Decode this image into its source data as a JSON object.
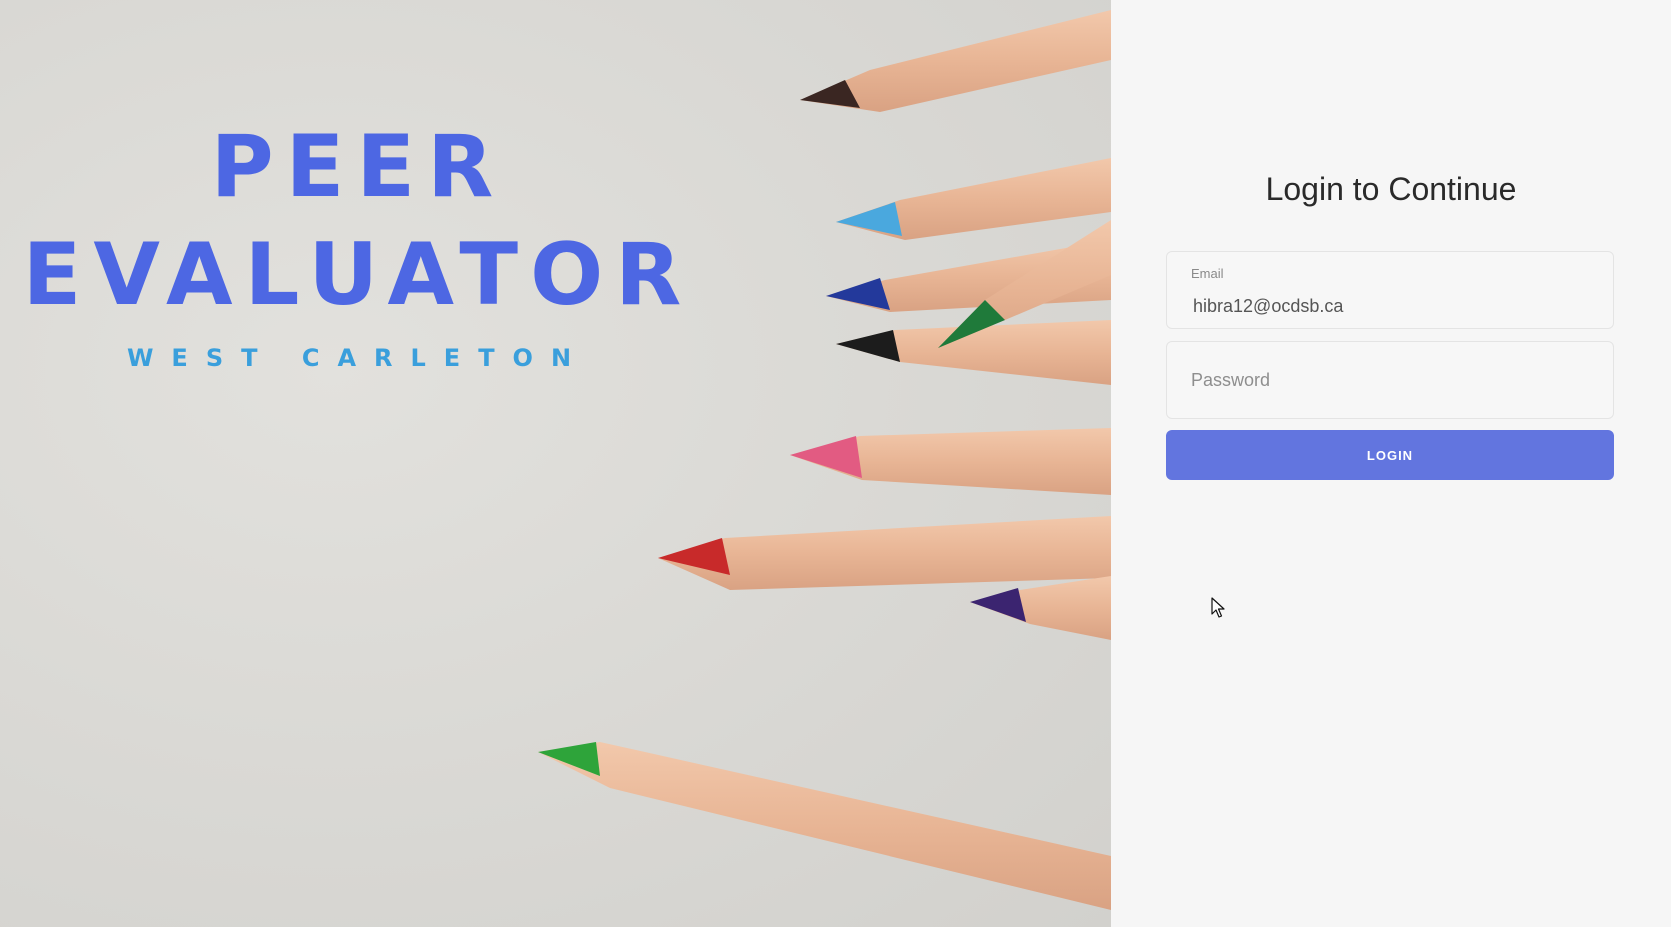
{
  "brand": {
    "title_line1": "PEER",
    "title_line2": "EVALUATOR",
    "subtitle": "WEST CARLETON"
  },
  "login": {
    "title": "Login to Continue",
    "email": {
      "label": "Email",
      "value": "hibra12@ocdsb.ca"
    },
    "password": {
      "placeholder": "Password"
    },
    "button_label": "LOGIN"
  },
  "colors": {
    "brand_blue": "#4d67e3",
    "subtitle_blue": "#3a9fdc",
    "button": "#6275df",
    "panel_bg": "#f6f6f6"
  },
  "icons": {
    "cursor": "mouse-pointer-icon"
  }
}
